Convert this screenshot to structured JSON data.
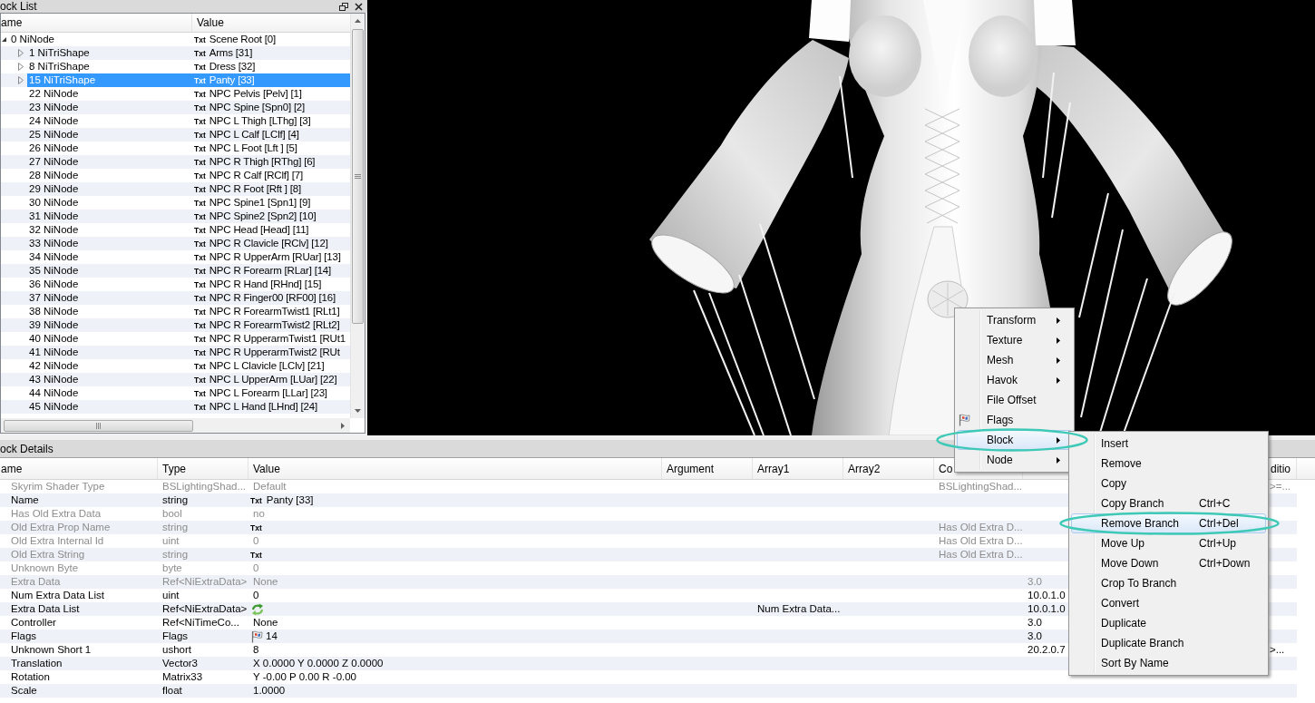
{
  "block_list": {
    "title": "ock List",
    "headers": {
      "column_1": "ame",
      "value": "Value"
    },
    "rows": [
      {
        "column_1": "0 NiNode",
        "tag": "Txt",
        "value": "Scene Root [0]",
        "expanded": true,
        "selected": false,
        "children": [
          {
            "column_1": "1 NiTriShape",
            "tag": "Txt",
            "value": "Arms [31]",
            "expanded": false,
            "selected": false
          },
          {
            "column_1": "8 NiTriShape",
            "tag": "Txt",
            "value": "Dress [32]",
            "expanded": false,
            "selected": false
          },
          {
            "column_1": "15 NiTriShape",
            "tag": "Txt",
            "value": "Panty [33]",
            "expanded": false,
            "selected": true
          },
          {
            "column_1": "22 NiNode",
            "tag": "Txt",
            "value": "NPC Pelvis [Pelv] [1]",
            "selected": false
          },
          {
            "column_1": "23 NiNode",
            "tag": "Txt",
            "value": "NPC Spine [Spn0] [2]",
            "selected": false
          },
          {
            "column_1": "24 NiNode",
            "tag": "Txt",
            "value": "NPC L Thigh [LThg] [3]",
            "selected": false
          },
          {
            "column_1": "25 NiNode",
            "tag": "Txt",
            "value": "NPC L Calf [LClf] [4]",
            "selected": false
          },
          {
            "column_1": "26 NiNode",
            "tag": "Txt",
            "value": "NPC L Foot [Lft ] [5]",
            "selected": false
          },
          {
            "column_1": "27 NiNode",
            "tag": "Txt",
            "value": "NPC R Thigh [RThg] [6]",
            "selected": false
          },
          {
            "column_1": "28 NiNode",
            "tag": "Txt",
            "value": "NPC R Calf [RClf] [7]",
            "selected": false
          },
          {
            "column_1": "29 NiNode",
            "tag": "Txt",
            "value": "NPC R Foot [Rft ] [8]",
            "selected": false
          },
          {
            "column_1": "30 NiNode",
            "tag": "Txt",
            "value": "NPC Spine1 [Spn1] [9]",
            "selected": false
          },
          {
            "column_1": "31 NiNode",
            "tag": "Txt",
            "value": "NPC Spine2 [Spn2] [10]",
            "selected": false
          },
          {
            "column_1": "32 NiNode",
            "tag": "Txt",
            "value": "NPC Head [Head] [11]",
            "selected": false
          },
          {
            "column_1": "33 NiNode",
            "tag": "Txt",
            "value": "NPC R Clavicle [RClv] [12]",
            "selected": false
          },
          {
            "column_1": "34 NiNode",
            "tag": "Txt",
            "value": "NPC R UpperArm [RUar] [13]",
            "selected": false
          },
          {
            "column_1": "35 NiNode",
            "tag": "Txt",
            "value": "NPC R Forearm [RLar] [14]",
            "selected": false
          },
          {
            "column_1": "36 NiNode",
            "tag": "Txt",
            "value": "NPC R Hand [RHnd] [15]",
            "selected": false
          },
          {
            "column_1": "37 NiNode",
            "tag": "Txt",
            "value": "NPC R Finger00 [RF00] [16]",
            "selected": false
          },
          {
            "column_1": "38 NiNode",
            "tag": "Txt",
            "value": "NPC R ForearmTwist1 [RLt1]",
            "selected": false
          },
          {
            "column_1": "39 NiNode",
            "tag": "Txt",
            "value": "NPC R ForearmTwist2 [RLt2]",
            "selected": false
          },
          {
            "column_1": "40 NiNode",
            "tag": "Txt",
            "value": "NPC R UpperarmTwist1 [RUt1",
            "selected": false
          },
          {
            "column_1": "41 NiNode",
            "tag": "Txt",
            "value": "NPC R UpperarmTwist2 [RUt",
            "selected": false
          },
          {
            "column_1": "42 NiNode",
            "tag": "Txt",
            "value": "NPC L Clavicle [LClv] [21]",
            "selected": false
          },
          {
            "column_1": "43 NiNode",
            "tag": "Txt",
            "value": "NPC L UpperArm [LUar] [22]",
            "selected": false
          },
          {
            "column_1": "44 NiNode",
            "tag": "Txt",
            "value": "NPC L Forearm [LLar] [23]",
            "selected": false
          },
          {
            "column_1": "45 NiNode",
            "tag": "Txt",
            "value": "NPC L Hand [LHnd] [24]",
            "selected": false
          }
        ]
      }
    ]
  },
  "block_details": {
    "title": "ock Details",
    "headers": {
      "column_1": "ame",
      "type": "Type",
      "value": "Value",
      "argument": "Argument",
      "array1": "Array1",
      "array2": "Array2",
      "column_7": "Co",
      "column_9": "ditio"
    },
    "rows": [
      {
        "column_1": "Skyrim Shader Type",
        "type": "BSLightingShad...",
        "kind": "plain",
        "value": "Default",
        "column_7": "BSLightingShad...",
        "column_9": ">=...",
        "disabled": true
      },
      {
        "column_1": "Name",
        "type": "string",
        "kind": "string",
        "tag": "Txt",
        "value": "Panty [33]",
        "disabled": false
      },
      {
        "column_1": "Has Old Extra Data",
        "type": "bool",
        "kind": "plain",
        "value": "no",
        "disabled": true
      },
      {
        "column_1": "Old Extra Prop Name",
        "type": "string",
        "kind": "string",
        "tag": "Txt",
        "column_7": "Has Old Extra D...",
        "disabled": true
      },
      {
        "column_1": "Old Extra Internal Id",
        "type": "uint",
        "kind": "plain",
        "value": "0",
        "column_7": "Has Old Extra D...",
        "disabled": true
      },
      {
        "column_1": "Old Extra String",
        "type": "string",
        "kind": "string",
        "tag": "Txt",
        "column_7": "Has Old Extra D...",
        "disabled": true
      },
      {
        "column_1": "Unknown Byte",
        "type": "byte",
        "kind": "plain",
        "value": "0",
        "disabled": true
      },
      {
        "column_1": "Extra Data",
        "type": "Ref<NiExtraData>",
        "kind": "plain",
        "value": "None",
        "column_8": "3.0",
        "disabled": true
      },
      {
        "column_1": "Num Extra Data List",
        "type": "uint",
        "kind": "plain",
        "value": "0",
        "column_8": "10.0.1.0",
        "disabled": false
      },
      {
        "column_1": "Extra Data List",
        "type": "Ref<NiExtraData>",
        "kind": "ref_list",
        "array1": "Num Extra Data...",
        "column_8": "10.0.1.0",
        "disabled": false
      },
      {
        "column_1": "Controller",
        "type": "Ref<NiTimeCo...",
        "kind": "plain",
        "value": "None",
        "column_8": "3.0",
        "disabled": false
      },
      {
        "column_1": "Flags",
        "type": "Flags",
        "kind": "flags",
        "value": "14",
        "column_8": "3.0",
        "disabled": false
      },
      {
        "column_1": "Unknown Short 1",
        "type": "ushort",
        "kind": "plain",
        "value": "8",
        "column_8": "20.2.0.7",
        "column_9": ">...",
        "disabled": false
      },
      {
        "column_1": "Translation",
        "type": "Vector3",
        "kind": "plain",
        "value": "X 0.0000 Y 0.0000 Z 0.0000",
        "disabled": false
      },
      {
        "column_1": "Rotation",
        "type": "Matrix33",
        "kind": "plain",
        "value": "Y -0.00 P 0.00 R -0.00",
        "disabled": false
      },
      {
        "column_1": "Scale",
        "type": "float",
        "kind": "plain",
        "value": "1.0000",
        "disabled": false
      }
    ]
  },
  "context_menu": {
    "items": [
      {
        "label": "Transform",
        "kind": "submenu",
        "selected": false,
        "circled": false
      },
      {
        "label": "Texture",
        "kind": "submenu",
        "selected": false,
        "circled": false
      },
      {
        "label": "Mesh",
        "kind": "submenu",
        "selected": false,
        "circled": false
      },
      {
        "label": "Havok",
        "kind": "submenu",
        "selected": false,
        "circled": false
      },
      {
        "label": "File Offset",
        "kind": "command",
        "selected": false,
        "circled": false
      },
      {
        "label": "Flags",
        "kind": "command_icon",
        "selected": false,
        "circled": false
      },
      {
        "label": "Block",
        "kind": "submenu",
        "selected": true,
        "circled": true
      },
      {
        "label": "Node",
        "kind": "submenu",
        "selected": false,
        "circled": false
      }
    ]
  },
  "submenu": {
    "items": [
      {
        "label": "Insert",
        "selected": false,
        "circled": false
      },
      {
        "label": "Remove",
        "selected": false,
        "circled": false
      },
      {
        "label": "Copy",
        "selected": false,
        "circled": false
      },
      {
        "label": "Copy Branch",
        "shortcut": "Ctrl+C",
        "selected": false,
        "circled": false
      },
      {
        "label": "Remove Branch",
        "shortcut": "Ctrl+Del",
        "selected": true,
        "circled": true
      },
      {
        "label": "Move Up",
        "shortcut": "Ctrl+Up",
        "selected": false,
        "circled": false
      },
      {
        "label": "Move Down",
        "shortcut": "Ctrl+Down",
        "selected": false,
        "circled": false
      },
      {
        "label": "Crop To Branch",
        "selected": false,
        "circled": false
      },
      {
        "label": "Convert",
        "selected": false,
        "circled": false
      },
      {
        "label": "Duplicate",
        "selected": false,
        "circled": false
      },
      {
        "label": "Duplicate Branch",
        "selected": false,
        "circled": false
      },
      {
        "label": "Sort By Name",
        "selected": false,
        "circled": false
      }
    ]
  }
}
